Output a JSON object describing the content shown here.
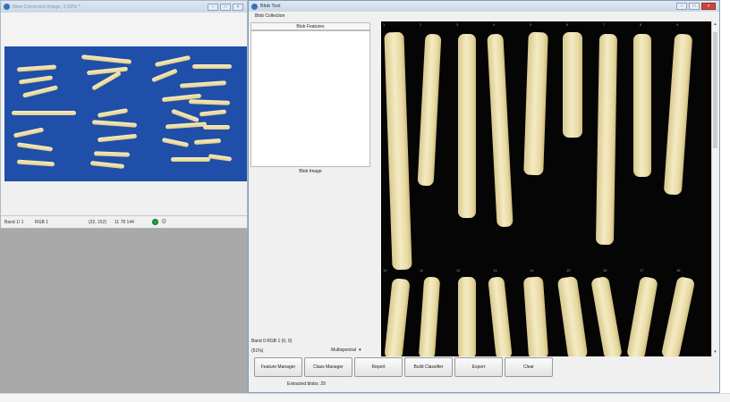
{
  "left_window": {
    "title": "New Corrected Image, 1:58% *",
    "controls": [
      "–",
      "□",
      "×"
    ],
    "status": {
      "band": "Band 1/ 1",
      "rgb": "RGB 1",
      "coords": "(32, 152)",
      "pixel": "11 78 144"
    }
  },
  "blob_window": {
    "title": "Blob Tool",
    "controls": [
      "–",
      "□",
      "×"
    ],
    "group_label": "Blob Collection",
    "features_header": "Blob Features",
    "blob_image_label": "Blob Image",
    "band_info": "Band 0   RGB 1   (0, 0)",
    "percent": "(51%)",
    "mode": "Multispectral",
    "mode_arrow": "▾",
    "scroll_up": "▴",
    "scroll_down": "▾",
    "blob_numbers_row1": [
      "1",
      "2",
      "3",
      "4",
      "5",
      "6",
      "7",
      "8",
      "9"
    ],
    "blob_numbers_row2": [
      "10",
      "11",
      "12",
      "13",
      "14",
      "15",
      "16",
      "17",
      "18"
    ],
    "buttons": [
      "Feature Manager",
      "Class Manager",
      "Report",
      "Build Classifier",
      "Export",
      "Clear"
    ],
    "extracted_status": "Extracted blobs: 29"
  },
  "icons": {
    "status_dot": "status-ok-icon",
    "gear": "settings-icon",
    "app": "app-icon"
  },
  "colors": {
    "image_background": "#1f4fa8",
    "blob_background": "#050505",
    "fry": "#f0e4b4",
    "status_ok": "#1aa33a"
  }
}
